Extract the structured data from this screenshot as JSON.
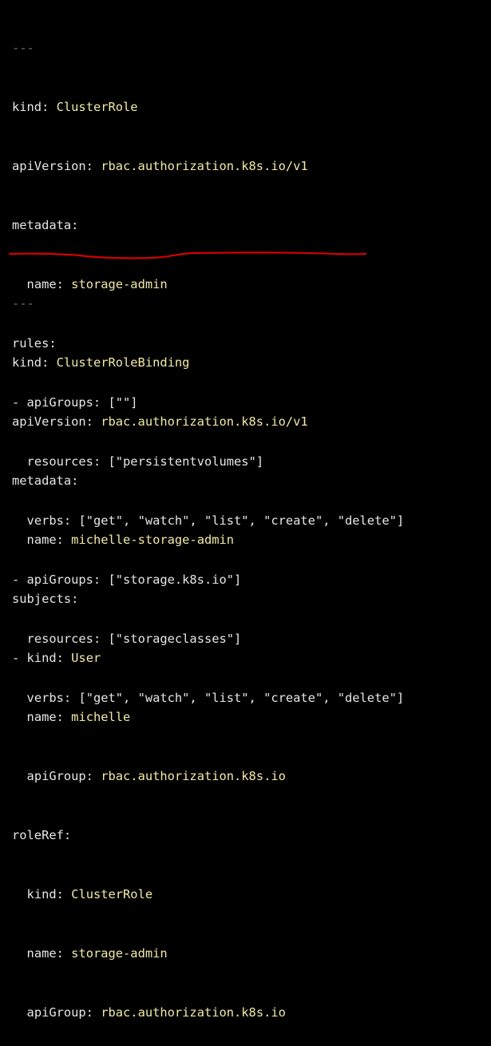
{
  "doc1": {
    "separator": "---",
    "kind_key": "kind:",
    "kind_val": "ClusterRole",
    "api_key": "apiVersion:",
    "api_val": "rbac.authorization.k8s.io/v1",
    "metadata_key": "metadata:",
    "name_key": "name:",
    "name_val": "storage-admin",
    "rules_key": "rules:",
    "rule1": {
      "apigroups_prefix": "- apiGroups:",
      "apigroups_val": "[\"\"]",
      "resources_key": "resources:",
      "resources_val": "[\"persistentvolumes\"]",
      "verbs_key": "verbs:",
      "verbs_val": "[\"get\", \"watch\", \"list\", \"create\", \"delete\"]"
    },
    "rule2": {
      "apigroups_prefix": "- apiGroups:",
      "apigroups_val": "[\"storage.k8s.io\"]",
      "resources_key": "resources:",
      "resources_val": "[\"storageclasses\"]",
      "verbs_key": "verbs:",
      "verbs_val": "[\"get\", \"watch\", \"list\", \"create\", \"delete\"]"
    }
  },
  "doc2": {
    "separator": "---",
    "kind_key": "kind:",
    "kind_val": "ClusterRoleBinding",
    "api_key": "apiVersion:",
    "api_val": "rbac.authorization.k8s.io/v1",
    "metadata_key": "metadata:",
    "name_key": "name:",
    "name_val": "michelle-storage-admin",
    "subjects_key": "subjects:",
    "subject_kind_prefix": "- kind:",
    "subject_kind_val": "User",
    "subject_name_key": "name:",
    "subject_name_val": "michelle",
    "subject_apigroup_key": "apiGroup:",
    "subject_apigroup_val": "rbac.authorization.k8s.io",
    "roleref_key": "roleRef:",
    "roleref_kind_key": "kind:",
    "roleref_kind_val": "ClusterRole",
    "roleref_name_key": "name:",
    "roleref_name_val": "storage-admin",
    "roleref_apigroup_key": "apiGroup:",
    "roleref_apigroup_val": "rbac.authorization.k8s.io"
  },
  "colors": {
    "background": "#000000",
    "key_text": "#e6e6e6",
    "value_text": "#f2e9a6",
    "separator_text": "#6c757d",
    "annotation_line": "#d40000"
  }
}
